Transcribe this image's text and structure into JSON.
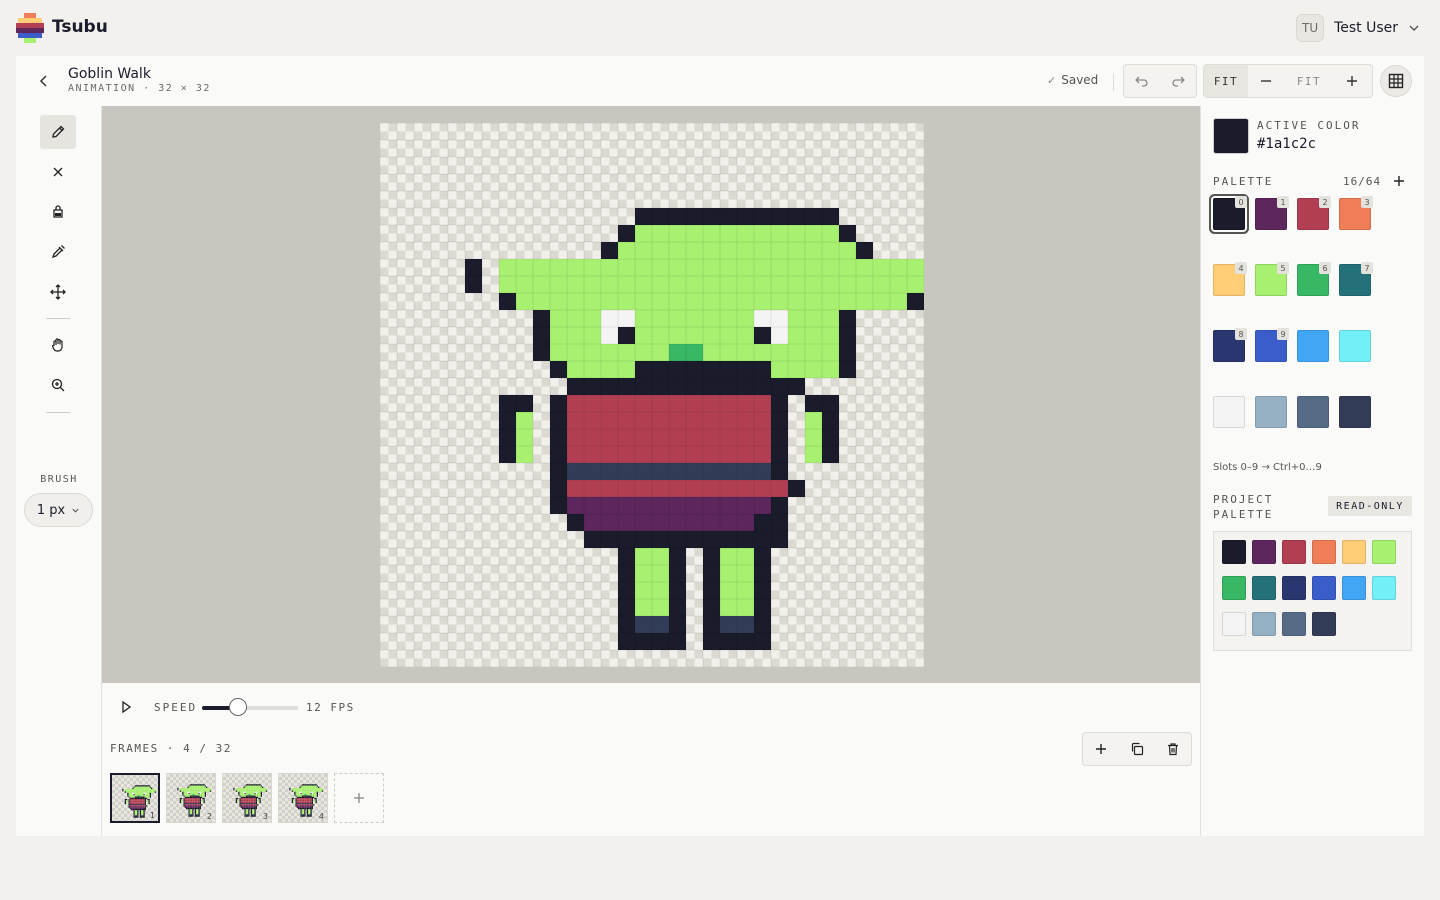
{
  "app": {
    "name": "Tsubu"
  },
  "user": {
    "initials": "TU",
    "name": "Test User"
  },
  "document": {
    "title": "Goblin Walk",
    "subtitle": "ANIMATION · 32 × 32",
    "status": "Saved"
  },
  "zoom": {
    "fit_label": "FIT",
    "value": "FIT"
  },
  "tools": {
    "items": [
      {
        "id": "pencil",
        "icon": "pencil-icon",
        "active": true
      },
      {
        "id": "eraser",
        "icon": "eraser-icon",
        "active": false
      },
      {
        "id": "fill",
        "icon": "bucket-icon",
        "active": false
      },
      {
        "id": "eyedropper",
        "icon": "eyedropper-icon",
        "active": false
      },
      {
        "id": "move",
        "icon": "move-icon",
        "active": false
      },
      {
        "id": "hand",
        "icon": "hand-icon",
        "active": false
      },
      {
        "id": "zoom",
        "icon": "zoom-in-icon",
        "active": false
      }
    ],
    "brush_label": "BRUSH",
    "brush_size": "1 px"
  },
  "timeline": {
    "speed_label": "SPEED",
    "fps": 12,
    "fps_label": "12 FPS",
    "fps_min": 1,
    "fps_max": 30,
    "frames_label": "FRAMES · 4 / 32",
    "frames": [
      {
        "number": "1",
        "active": true
      },
      {
        "number": "2",
        "active": false
      },
      {
        "number": "3",
        "active": false
      },
      {
        "number": "4",
        "active": false
      }
    ]
  },
  "color": {
    "active_label": "ACTIVE COLOR",
    "active_hex": "#1a1c2c",
    "palette_label": "PALETTE",
    "palette_count": "16/64",
    "palette": [
      {
        "hex": "#1a1c2c",
        "index": "0"
      },
      {
        "hex": "#5d275d",
        "index": "1"
      },
      {
        "hex": "#b13e53",
        "index": "2"
      },
      {
        "hex": "#ef7d57",
        "index": "3"
      },
      {
        "hex": "#ffcd75",
        "index": "4"
      },
      {
        "hex": "#a7f070",
        "index": "5"
      },
      {
        "hex": "#38b764",
        "index": "6"
      },
      {
        "hex": "#257179",
        "index": "7"
      },
      {
        "hex": "#29366f",
        "index": "8"
      },
      {
        "hex": "#3b5dc9",
        "index": "9"
      },
      {
        "hex": "#41a6f6",
        "index": ""
      },
      {
        "hex": "#73eff7",
        "index": ""
      },
      {
        "hex": "#f4f4f4",
        "index": ""
      },
      {
        "hex": "#94b0c2",
        "index": ""
      },
      {
        "hex": "#566c86",
        "index": ""
      },
      {
        "hex": "#333c57",
        "index": ""
      }
    ],
    "slots_hint": "Slots 0–9 → Ctrl+0…9",
    "project_label": "PROJECT PALETTE",
    "readonly_label": "READ-ONLY"
  },
  "sprite": {
    "size": 32,
    "offset": {
      "x": 5,
      "y": 5
    },
    "legend": {
      ".": null,
      "K": "#1a1c2c",
      "G": "#a7f070",
      "W": "#f4f4f4",
      "M": "#38b764",
      "R": "#b13e53",
      "S": "#333c57",
      "P": "#5d275d"
    },
    "rows": [
      "..........KKKKKKKKKKKK..........",
      ".........KGGGGGGGGGGGGK.........",
      "........KGGGGGGGGGGGGGGK........",
      "K.GGGGGGGGGGGGGGGGGGGGGGGGG.K",
      "K.GGGGGGGGGGGGGGGGGGGGGGGGG.K",
      "..KGGGGGGGGGGGGGGGGGGGGGGGK..",
      "....KGGGWWGGGGGGGWWGGGK....",
      "....KGGGWKGGGGGGGKWGGGK....",
      "....KGGGGGGGMMGGGGGGGGK....",
      ".....KGGGGKKKKKKKKGGGGK.....",
      "......KKKKKKKKKKKKKK......",
      "..KK.KRRRRRRRRRRRRK.KK..",
      "..KG.KRRRRRRRRRRRRK.GK..",
      "..KG.KRRRRRRRRRRRRK.GK..",
      "..KG.KRRRRRRRRRRRRK.GK..",
      ".....KSSSSSSSSSSSSK.....",
      ".....KRRRRRRRRRRRRRK....",
      ".....KPPPPPPPPPPPPK.....",
      "......KPPPPPPPPPPKK.....",
      ".......KKKKKKKKKKKK.....",
      ".........KGGK.KGGK......",
      ".........KGGK.KGGK......",
      ".........KGGK.KGGK......",
      ".........KGGK.KGGK......",
      ".........KSSK.KSSK......",
      ".........KKKK.KKKK......"
    ]
  }
}
